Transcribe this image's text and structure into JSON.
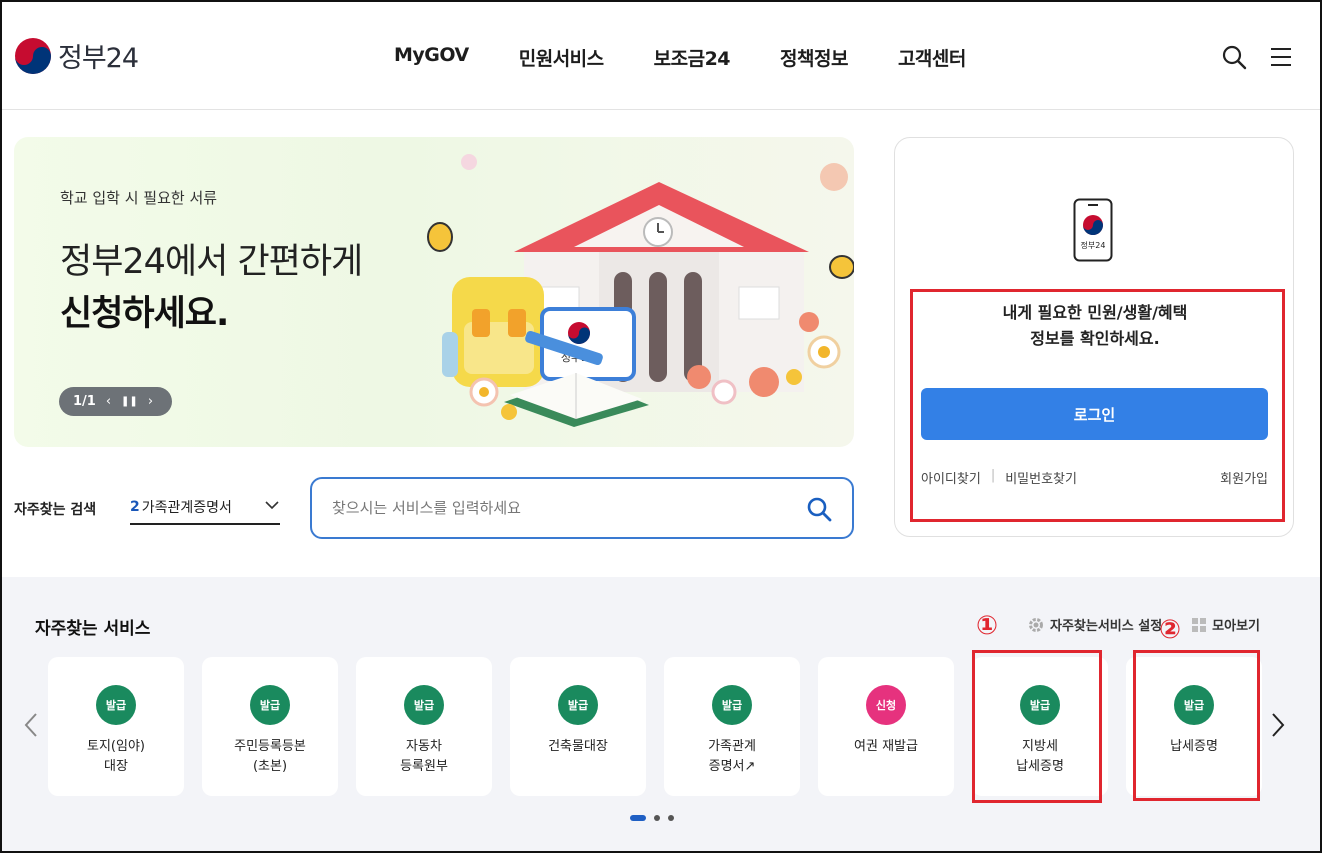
{
  "header": {
    "logo_text": "정부24",
    "nav": [
      "MyGOV",
      "민원서비스",
      "보조금24",
      "정책정보",
      "고객센터"
    ]
  },
  "banner": {
    "kicker": "학교 입학 시 필요한 서류",
    "title_line1": "정부24에서 간편하게",
    "title_line2": "신청하세요.",
    "page_indicator": "1/1",
    "art_badge_text": "정부24"
  },
  "login": {
    "phone_label": "정부24",
    "message_line1": "내게 필요한 민원/생활/혜택",
    "message_line2": "정보를 확인하세요.",
    "login_button": "로그인",
    "find_id": "아이디찾기",
    "find_password": "비밀번호찾기",
    "signup": "회원가입"
  },
  "search": {
    "fav_label": "자주찾는 검색",
    "fav_rank": "2",
    "fav_value": "가족관계증명서",
    "placeholder": "찾으시는 서비스를 입력하세요"
  },
  "services": {
    "title": "자주찾는 서비스",
    "settings_label": "자주찾는서비스 설정",
    "view_all_label": "모아보기",
    "mark_1": "①",
    "mark_2": "②",
    "cards": [
      {
        "badge": "발급",
        "name": "토지(임야)\n대장"
      },
      {
        "badge": "발급",
        "name": "주민등록등본\n(초본)"
      },
      {
        "badge": "발급",
        "name": "자동차\n등록원부"
      },
      {
        "badge": "발급",
        "name": "건축물대장"
      },
      {
        "badge": "발급",
        "name": "가족관계\n증명서↗"
      },
      {
        "badge": "신청",
        "name": "여권 재발급"
      },
      {
        "badge": "발급",
        "name": "지방세\n납세증명"
      },
      {
        "badge": "발급",
        "name": "납세증명"
      }
    ]
  },
  "colors": {
    "badge_issue": "#1a8a5e",
    "badge_apply": "#e6327e",
    "primary": "#3380e6",
    "highlight": "#e0262f"
  }
}
